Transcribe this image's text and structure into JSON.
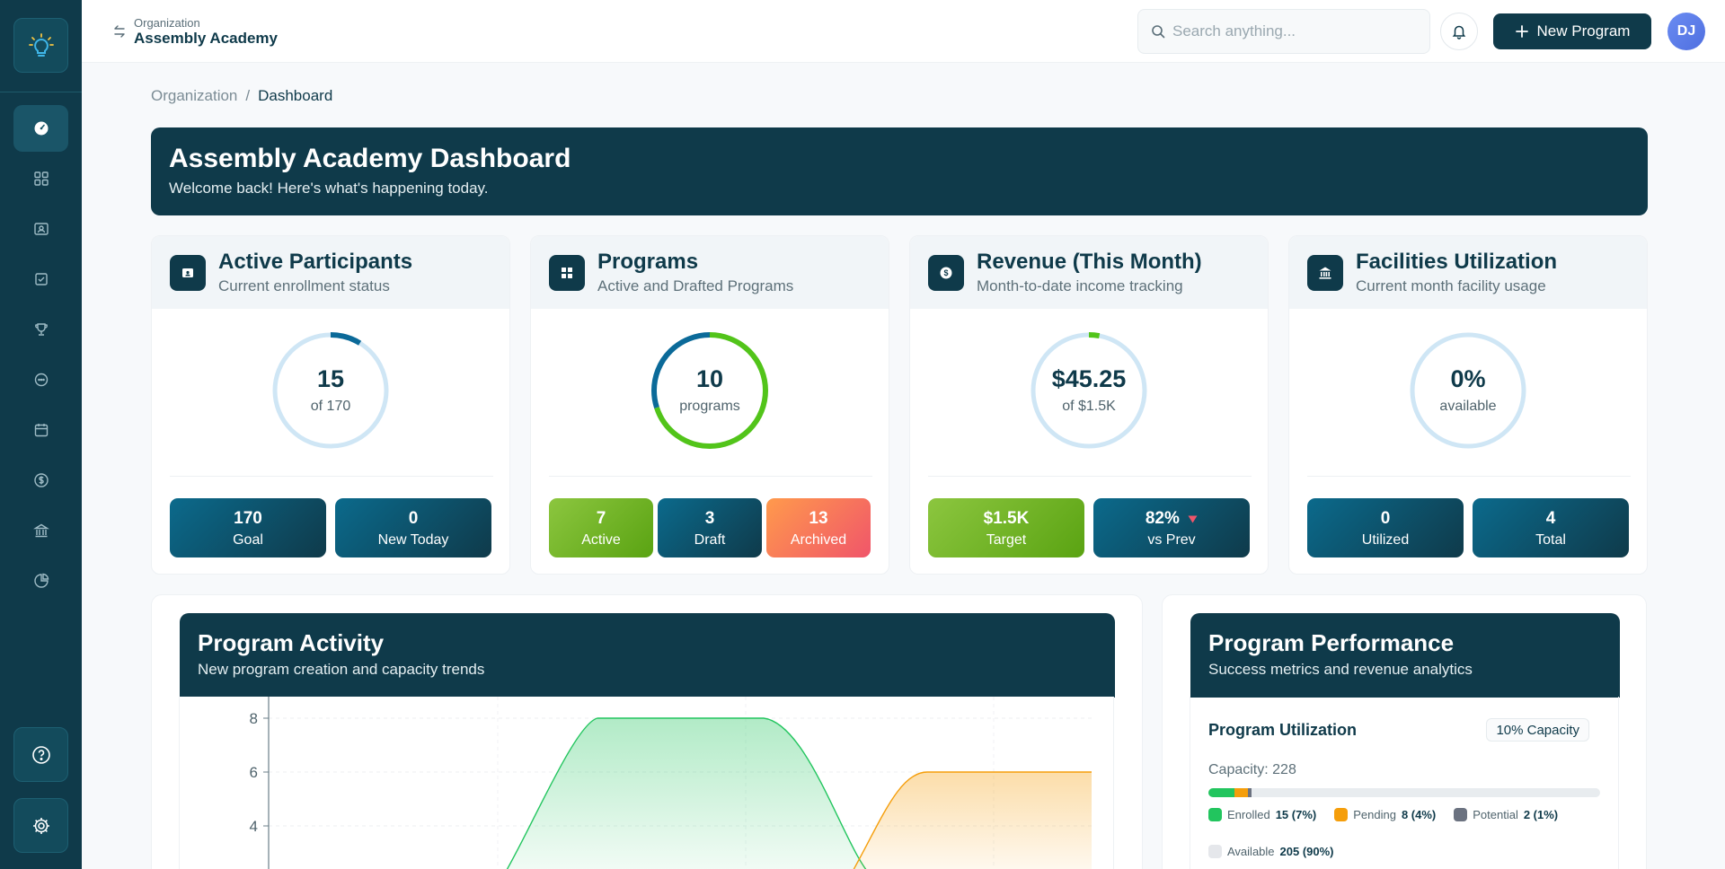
{
  "topbar": {
    "org_small": "Organization",
    "org_name": "Assembly Academy",
    "search_placeholder": "Search anything...",
    "new_program_label": "New Program",
    "avatar_initials": "DJ"
  },
  "breadcrumb": {
    "root": "Organization",
    "separator": "/",
    "current": "Dashboard"
  },
  "hero": {
    "title": "Assembly Academy Dashboard",
    "subtitle": "Welcome back! Here's what's happening today."
  },
  "cards": {
    "participants": {
      "title": "Active Participants",
      "subtitle": "Current enrollment status",
      "value": "15",
      "label": "of 170",
      "progress": 0.088,
      "stats": [
        {
          "value": "170",
          "label": "Goal"
        },
        {
          "value": "0",
          "label": "New Today"
        }
      ]
    },
    "programs": {
      "title": "Programs",
      "subtitle": "Active and Drafted Programs",
      "value": "10",
      "label": "programs",
      "stats": [
        {
          "value": "7",
          "label": "Active"
        },
        {
          "value": "3",
          "label": "Draft"
        },
        {
          "value": "13",
          "label": "Archived"
        }
      ]
    },
    "revenue": {
      "title": "Revenue (This Month)",
      "subtitle": "Month-to-date income tracking",
      "value": "$45.25",
      "label": "of $1.5K",
      "progress": 0.03,
      "stats": [
        {
          "value": "$1.5K",
          "label": "Target"
        },
        {
          "value": "82%",
          "label": "vs Prev"
        }
      ]
    },
    "facilities": {
      "title": "Facilities Utilization",
      "subtitle": "Current month facility usage",
      "value": "0%",
      "label": "available",
      "progress": 0,
      "stats": [
        {
          "value": "0",
          "label": "Utilized"
        },
        {
          "value": "4",
          "label": "Total"
        }
      ]
    }
  },
  "activity": {
    "title": "Program Activity",
    "subtitle": "New program creation and capacity trends",
    "chart_data": {
      "type": "area",
      "y_ticks": [
        "8",
        "6",
        "4"
      ],
      "ylim": [
        0,
        8
      ],
      "grid": true,
      "series": [
        {
          "color": "#22c55e",
          "values": [
            0,
            2,
            8,
            8,
            0
          ]
        },
        {
          "color": "#f59e0b",
          "values": [
            0,
            0,
            0,
            0,
            6
          ]
        }
      ]
    }
  },
  "performance": {
    "title": "Program Performance",
    "subtitle": "Success metrics and revenue analytics",
    "utilization_title": "Program Utilization",
    "capacity_badge": "10% Capacity",
    "capacity_label": "Capacity: 228",
    "legend": [
      {
        "label": "Enrolled",
        "value": "15 (7%)",
        "color": "#22c55e",
        "fraction": 0.066
      },
      {
        "label": "Pending",
        "value": "8 (4%)",
        "color": "#f59e0b",
        "fraction": 0.035
      },
      {
        "label": "Potential",
        "value": "2 (1%)",
        "color": "#6b7280",
        "fraction": 0.009
      },
      {
        "label": "Available",
        "value": "205 (90%)",
        "color": "#e5e7eb",
        "fraction": 0.89
      }
    ]
  }
}
